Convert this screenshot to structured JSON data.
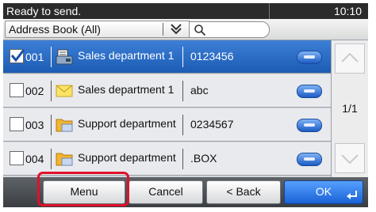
{
  "status": {
    "message": "Ready to send.",
    "time": "10:10"
  },
  "toolbar": {
    "address_book_label": "Address Book (All)"
  },
  "rows": [
    {
      "number": "001",
      "name": "Sales department 1",
      "destination": "0123456",
      "checked": true,
      "icon": "fax-icon"
    },
    {
      "number": "002",
      "name": "Sales department 1",
      "destination": "abc",
      "checked": false,
      "icon": "email-icon"
    },
    {
      "number": "003",
      "name": "Support department",
      "destination": "0234567",
      "checked": false,
      "icon": "folder-icon"
    },
    {
      "number": "004",
      "name": "Support department",
      "destination": ".BOX",
      "checked": false,
      "icon": "folder-icon"
    }
  ],
  "pager": {
    "text": "1/1"
  },
  "buttons": {
    "menu": "Menu",
    "cancel": "Cancel",
    "back": "< Back",
    "ok": "OK"
  },
  "colors": {
    "selected_row": "#2a6cc8",
    "status_bar": "#2b2b2b",
    "highlight": "#e0102a",
    "ok_button": "#1a62d6"
  }
}
